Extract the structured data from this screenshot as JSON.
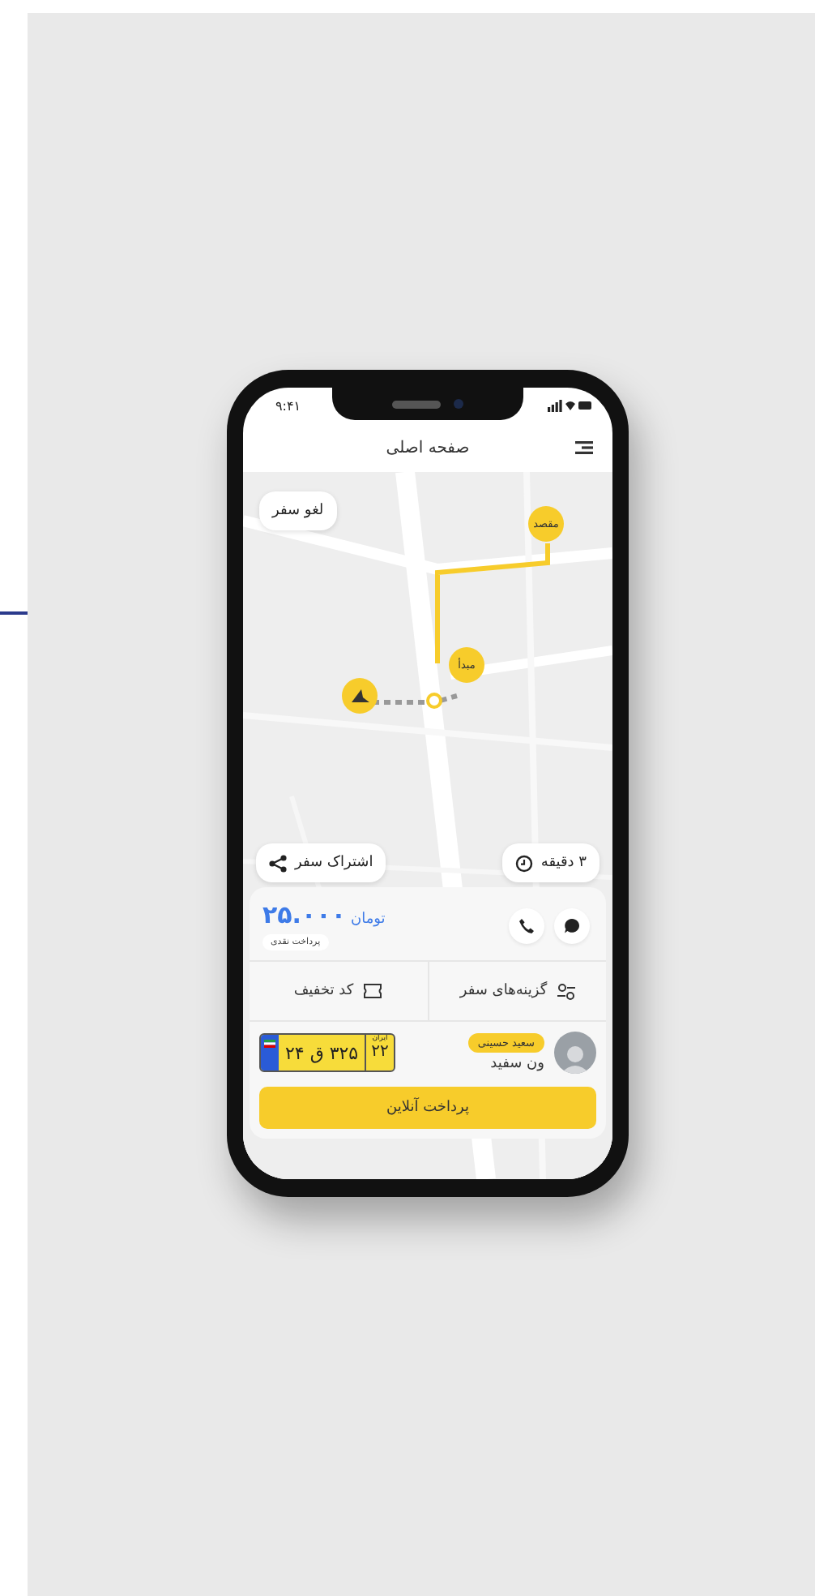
{
  "status_bar": {
    "time": "۹:۴۱"
  },
  "header": {
    "title": "صفحه اصلی"
  },
  "map": {
    "cancel_button": "لغو سفر",
    "markers": [
      {
        "kind": "destination",
        "label": "مقصد"
      },
      {
        "kind": "origin",
        "label": "مبدأ"
      },
      {
        "kind": "car"
      }
    ],
    "share_button": "اشتراک سفر",
    "eta": "۳ دقیقه"
  },
  "trip": {
    "price": "۲۵.۰۰۰",
    "currency": "تومان",
    "payment_method": "پرداخت نقدی",
    "options": [
      {
        "kind": "trip-options",
        "label": "گزینه‌های سفر"
      },
      {
        "kind": "discount",
        "label": "کد تخفیف"
      }
    ],
    "driver": {
      "name": "سعید حسینی",
      "car": "ون سفید"
    },
    "plate": {
      "region_label": "ایران",
      "region": "۲۲",
      "number": "۳۲۵ ق ۲۴"
    },
    "pay_button": "پرداخت آنلاین"
  }
}
